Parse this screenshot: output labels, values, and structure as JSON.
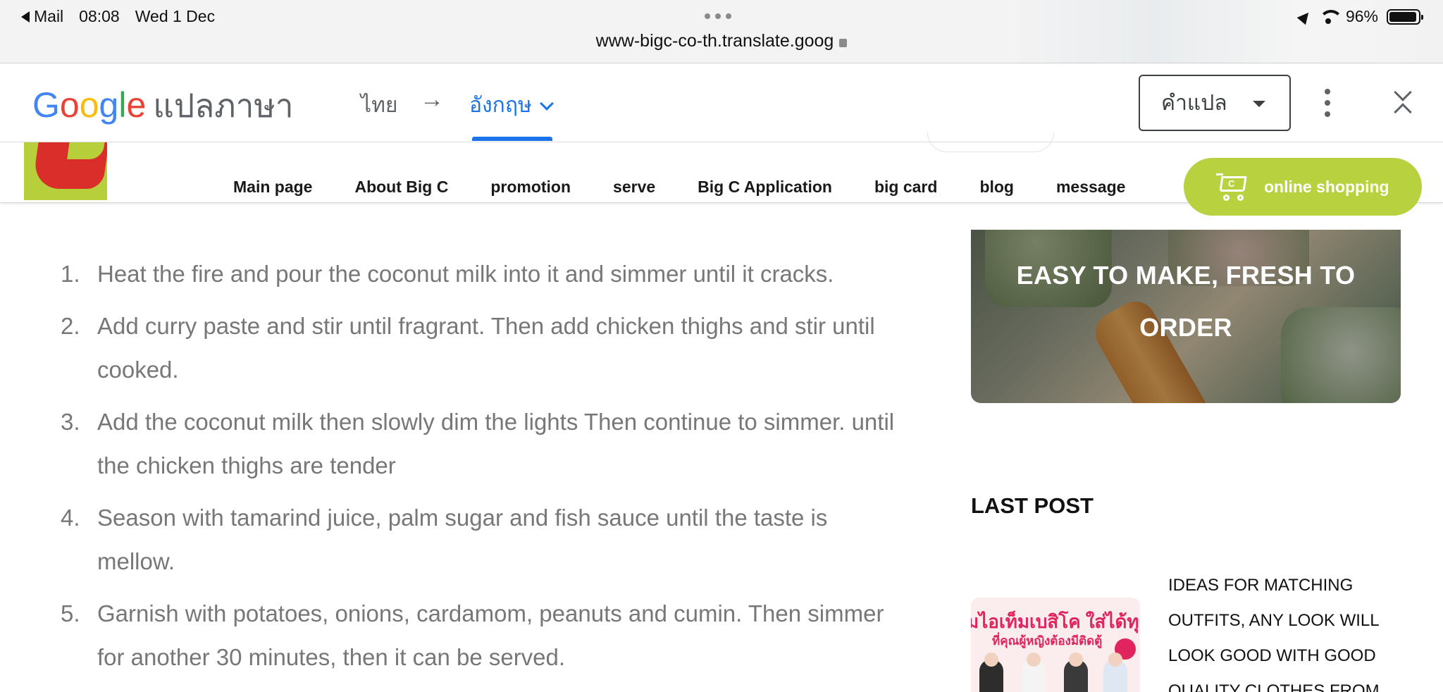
{
  "status_bar": {
    "back_app": "Mail",
    "time": "08:08",
    "date": "Wed 1 Dec",
    "url": "www-bigc-co-th.translate.goog",
    "battery": "96%",
    "battery_level": 0.96
  },
  "translate_bar": {
    "logo_g1": "G",
    "logo_o1": "o",
    "logo_o2": "o",
    "logo_g2": "g",
    "logo_l": "l",
    "logo_e": "e",
    "logo_suffix": "แปลภาษา",
    "source_lang": "ไทย",
    "arrow": "→",
    "target_lang": "อังกฤษ",
    "mode_select": "คำแปล"
  },
  "site_nav": {
    "links": [
      "Main page",
      "About Big C",
      "promotion",
      "serve",
      "Big C Application",
      "big card",
      "blog",
      "message"
    ],
    "shop_button": "online shopping",
    "cart_symbol": "C",
    "brand_color": "#b7d13f"
  },
  "article": {
    "steps": [
      {
        "num": "1.",
        "text": "Heat the fire and pour the coconut milk into it and simmer until it cracks."
      },
      {
        "num": "2.",
        "text": "Add curry paste and stir until fragrant. Then add chicken thighs and stir until cooked."
      },
      {
        "num": "3.",
        "text": "Add the coconut milk then slowly dim the lights Then continue to simmer. until the chicken thighs are tender"
      },
      {
        "num": "4.",
        "text": "Season with tamarind juice, palm sugar and fish sauce until the taste is mellow."
      },
      {
        "num": "5.",
        "text": "Garnish with potatoes, onions, cardamom, peanuts and cumin. Then simmer for another 30 minutes, then it can be served."
      }
    ]
  },
  "sidebar": {
    "promo_title": "EASY TO MAKE, FRESH TO ORDER",
    "last_post_heading": "LAST POST",
    "post_thumb_line1": "มไอเท็มเบสิโค ใส่ได้ทุกว",
    "post_thumb_line2": "ที่คุณผู้หญิงต้องมีติดตู้",
    "post_title": "IDEAS FOR MATCHING OUTFITS, ANY LOOK WILL LOOK GOOD WITH GOOD QUALITY CLOTHES FROM"
  }
}
